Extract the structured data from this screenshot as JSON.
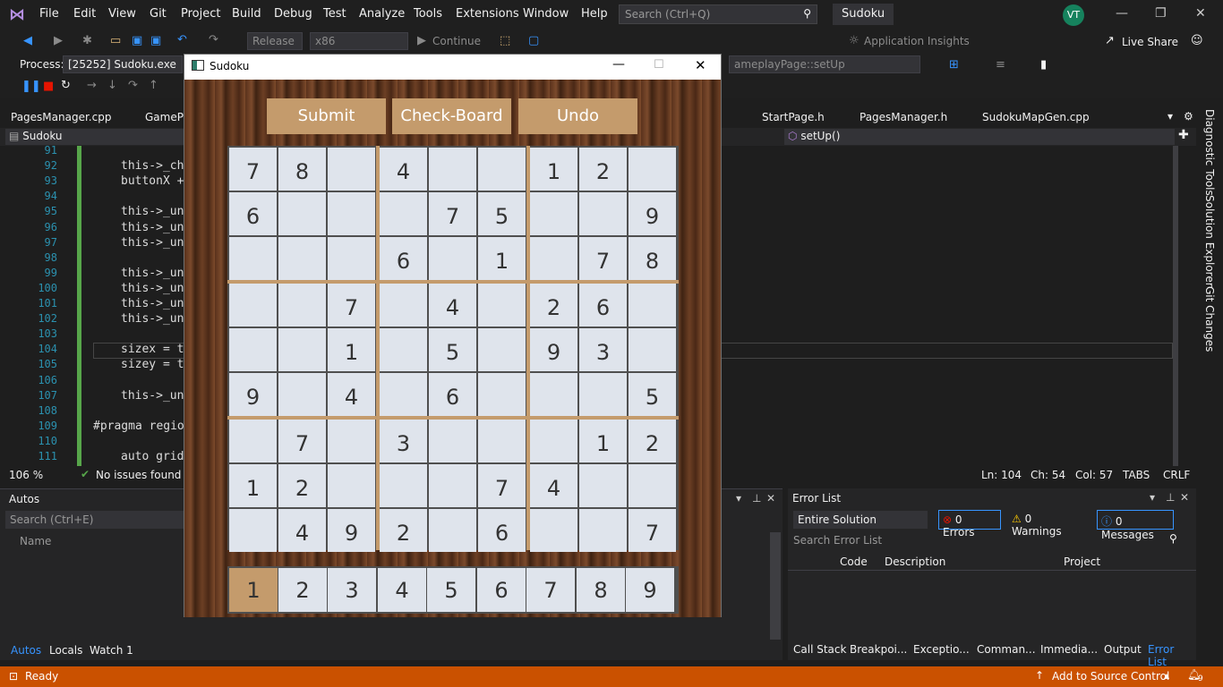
{
  "menubar": {
    "items": [
      "File",
      "Edit",
      "View",
      "Git",
      "Project",
      "Build",
      "Debug",
      "Test",
      "Analyze",
      "Tools",
      "Extensions",
      "Window",
      "Help"
    ],
    "search_placeholder": "Search (Ctrl+Q)",
    "solution_name": "Sudoku",
    "avatar_initials": "VT"
  },
  "toolbar": {
    "config": "Release",
    "platform": "x86",
    "continue_label": "Continue",
    "app_insights": "Application Insights",
    "live_share": "Live Share"
  },
  "debug_bar": {
    "process_label": "Process:",
    "process_value": "[25252] Sudoku.exe",
    "stack_frame": "ameplayPage::setUp"
  },
  "doc_tabs": [
    "PagesManager.cpp",
    "GamePl",
    "StartPage.h",
    "PagesManager.h",
    "SudokuMapGen.cpp"
  ],
  "navbar": {
    "project": "Sudoku",
    "member": "setUp()"
  },
  "editor": {
    "lines": [
      {
        "n": "91",
        "code": ""
      },
      {
        "n": "92",
        "code": "this->_ch"
      },
      {
        "n": "93",
        "code": "buttonX +"
      },
      {
        "n": "94",
        "code": ""
      },
      {
        "n": "95",
        "code": "this->_un"
      },
      {
        "n": "96",
        "code": "this->_un"
      },
      {
        "n": "97",
        "code": "this->_un"
      },
      {
        "n": "98",
        "code": ""
      },
      {
        "n": "99",
        "code": "this->_un"
      },
      {
        "n": "100",
        "code": "this->_un"
      },
      {
        "n": "101",
        "code": "this->_un"
      },
      {
        "n": "102",
        "code": "this->_un"
      },
      {
        "n": "103",
        "code": ""
      },
      {
        "n": "104",
        "code": "sizex = t"
      },
      {
        "n": "105",
        "code": "sizey = t"
      },
      {
        "n": "106",
        "code": ""
      },
      {
        "n": "107",
        "code": "this->_un"
      },
      {
        "n": "108",
        "code": ""
      },
      {
        "n": "109",
        "code": "#pragma regio"
      },
      {
        "n": "110",
        "code": ""
      },
      {
        "n": "111",
        "code": "auto grid"
      }
    ],
    "zoom": "106 %",
    "issues": "No issues found",
    "ln": "Ln: 104",
    "ch": "Ch: 54",
    "col": "Col: 57",
    "tabs": "TABS",
    "eol": "CRLF"
  },
  "autos": {
    "title": "Autos",
    "search_placeholder": "Search (Ctrl+E)",
    "col_name": "Name",
    "bottom_tabs": [
      "Autos",
      "Locals",
      "Watch 1"
    ]
  },
  "error_list": {
    "title": "Error List",
    "scope": "Entire Solution",
    "errors": "0 Errors",
    "warnings": "0 Warnings",
    "messages": "0 Messages",
    "search_placeholder": "Search Error List",
    "columns": [
      "Code",
      "Description",
      "Project"
    ],
    "bottom_tabs": [
      "Call Stack",
      "Breakpoi...",
      "Exceptio...",
      "Comman...",
      "Immedia...",
      "Output",
      "Error List"
    ]
  },
  "right_tabs": [
    "Diagnostic Tools",
    "Solution Explorer",
    "Git Changes"
  ],
  "status": {
    "ready": "Ready",
    "source_control": "Add to Source Control",
    "notifications": "9"
  },
  "sudoku": {
    "window_title": "Sudoku",
    "buttons": {
      "submit": "Submit",
      "check": "Check-Board",
      "undo": "Undo"
    },
    "grid": [
      [
        "7",
        "8",
        "",
        "4",
        "",
        "",
        "1",
        "2",
        ""
      ],
      [
        "6",
        "",
        "",
        "",
        "7",
        "5",
        "",
        "",
        "9"
      ],
      [
        "",
        "",
        "",
        "6",
        "",
        "1",
        "",
        "7",
        "8"
      ],
      [
        "",
        "",
        "7",
        "",
        "4",
        "",
        "2",
        "6",
        ""
      ],
      [
        "",
        "",
        "1",
        "",
        "5",
        "",
        "9",
        "3",
        ""
      ],
      [
        "9",
        "",
        "4",
        "",
        "6",
        "",
        "",
        "",
        "5"
      ],
      [
        "",
        "7",
        "",
        "3",
        "",
        "",
        "",
        "1",
        "2"
      ],
      [
        "1",
        "2",
        "",
        "",
        "",
        "7",
        "4",
        "",
        ""
      ],
      [
        "",
        "4",
        "9",
        "2",
        "",
        "6",
        "",
        "",
        "7"
      ]
    ],
    "numpad": [
      "1",
      "2",
      "3",
      "4",
      "5",
      "6",
      "7",
      "8",
      "9"
    ],
    "selected_number": "1"
  }
}
